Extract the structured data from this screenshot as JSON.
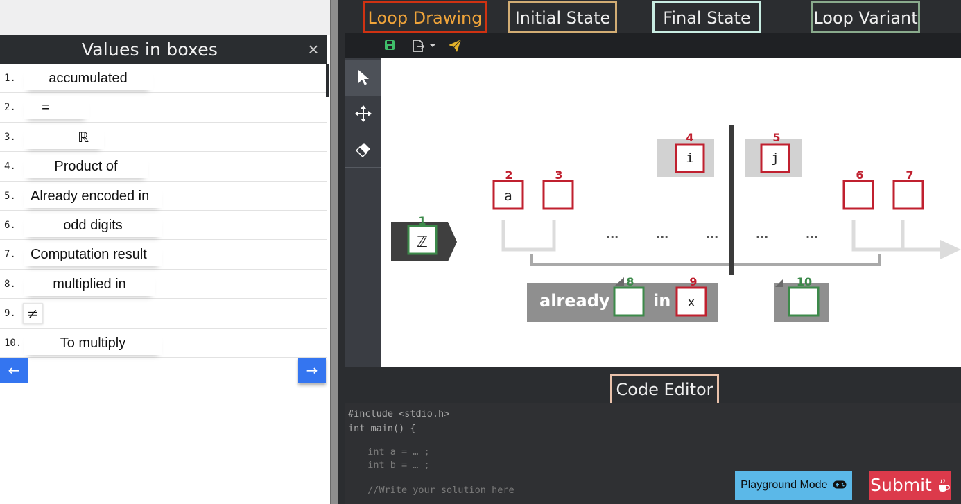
{
  "values_panel": {
    "title": "Values in boxes",
    "close_icon": "×",
    "items": [
      {
        "num": "1.",
        "label": "accumulated"
      },
      {
        "num": "2.",
        "label": "="
      },
      {
        "num": "3.",
        "label": "ℝ"
      },
      {
        "num": "4.",
        "label": "Product of"
      },
      {
        "num": "5.",
        "label": "Already encoded in"
      },
      {
        "num": "6.",
        "label": "odd digits"
      },
      {
        "num": "7.",
        "label": "Computation result"
      },
      {
        "num": "8.",
        "label": "multiplied in"
      },
      {
        "num": "9.",
        "label": "≠"
      },
      {
        "num": "10.",
        "label": "To multiply"
      }
    ],
    "prev_icon": "←",
    "next_icon": "→"
  },
  "tabs": {
    "loop_drawing": "Loop Drawing",
    "initial_state": "Initial State",
    "final_state": "Final State",
    "loop_variant": "Loop Variant"
  },
  "toolbar_icons": [
    "save-icon",
    "export-icon",
    "send-icon"
  ],
  "tools": [
    "select-tool-icon",
    "move-tool-icon",
    "eraser-icon"
  ],
  "canvas": {
    "boxes": [
      {
        "num": "1",
        "value": "ℤ"
      },
      {
        "num": "2",
        "value": "a"
      },
      {
        "num": "3",
        "value": ""
      },
      {
        "num": "4",
        "value": "i"
      },
      {
        "num": "5",
        "value": "j"
      },
      {
        "num": "6",
        "value": ""
      },
      {
        "num": "7",
        "value": ""
      },
      {
        "num": "8",
        "value": ""
      },
      {
        "num": "9",
        "value": "x"
      },
      {
        "num": "10",
        "value": ""
      }
    ],
    "ellipsis": "...",
    "already_label": "already",
    "in_label": "in"
  },
  "editor": {
    "title": "Code Editor",
    "lines": [
      "#include <stdio.h>",
      "int main() {",
      "  int a = … ;",
      "  int b = … ;",
      "  //Write your solution here"
    ]
  },
  "buttons": {
    "playground": "Playground Mode",
    "submit": "Submit"
  },
  "colors": {
    "accent_red": "#c0202f",
    "accent_green": "#3c8a4a",
    "nav_blue": "#3475f0",
    "tab_active_border": "#cf3212",
    "tab_active_text": "#f0a43a"
  }
}
